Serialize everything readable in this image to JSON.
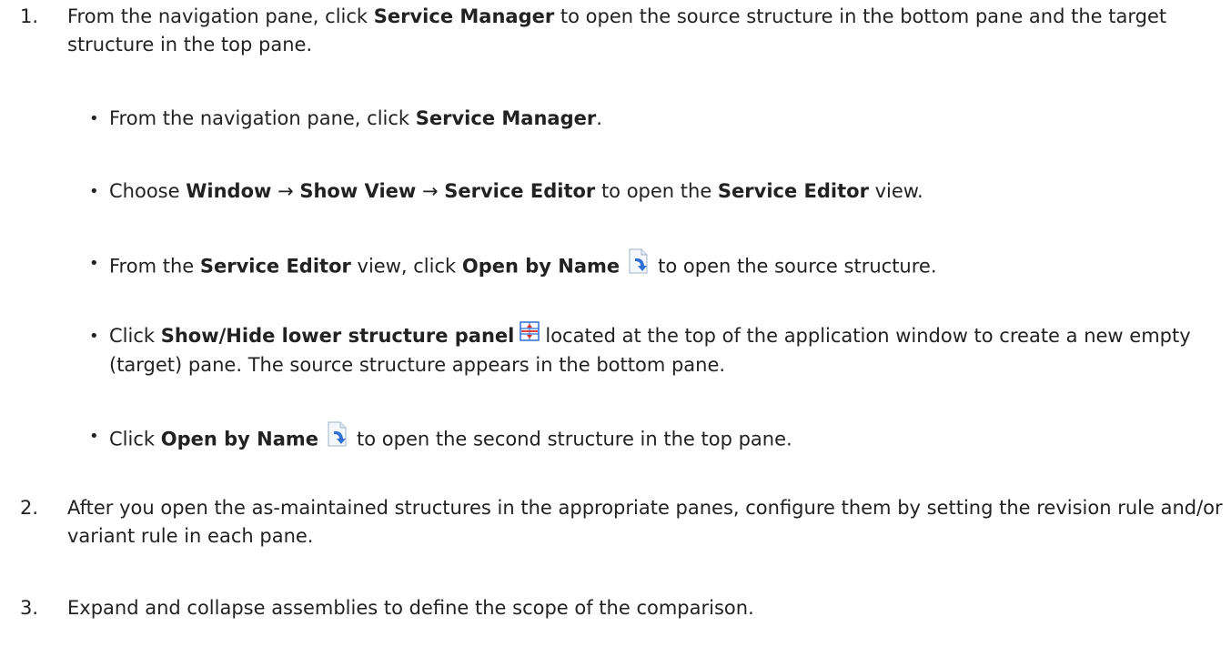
{
  "steps": [
    {
      "number": "1.",
      "parts": [
        "From the navigation pane, click ",
        "Service Manager",
        " to open the source structure in the bottom pane and the target structure in the top pane."
      ],
      "substeps": [
        {
          "parts": [
            "From the navigation pane, click ",
            "Service Manager",
            "."
          ]
        },
        {
          "parts": [
            "Choose ",
            "Window",
            " → ",
            "Show View",
            " → ",
            "Service Editor",
            " to open the ",
            "Service Editor",
            " view."
          ]
        },
        {
          "parts": [
            "From the ",
            "Service Editor",
            " view, click ",
            "Open by Name",
            "to open the source structure."
          ],
          "icon": "open-by-name-icon"
        },
        {
          "parts": [
            "Click ",
            "Show/Hide lower structure panel",
            "located at the top of the application window to create a new empty (target) pane. The source structure appears in the bottom pane."
          ],
          "icon": "show-hide-lower-structure-panel-icon"
        },
        {
          "parts": [
            "Click ",
            "Open by Name",
            "to open the second structure in the top pane."
          ],
          "icon": "open-by-name-icon"
        }
      ]
    },
    {
      "number": "2.",
      "text": "After you open the as-maintained structures in the appropriate panes, configure them by setting the revision rule and/or variant rule in each pane."
    },
    {
      "number": "3.",
      "text": "Expand and collapse assemblies to define the scope of the comparison."
    }
  ],
  "colors": {
    "text": "#222222",
    "icon_blue": "#2f6fd6",
    "icon_red": "#d62828"
  }
}
